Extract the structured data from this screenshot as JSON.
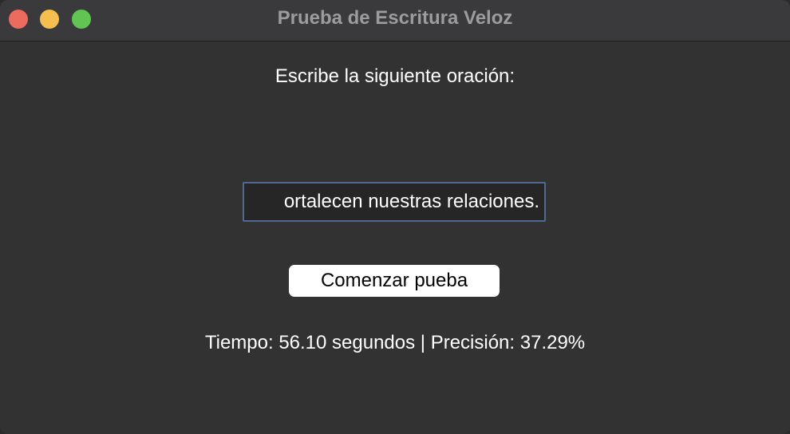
{
  "window": {
    "title": "Prueba de Escritura Veloz"
  },
  "main": {
    "prompt": "Escribe la siguiente oración:",
    "sentence_value": "ortalecen nuestras relaciones.",
    "start_button_label": "Comenzar pueba",
    "result": "Tiempo: 56.10 segundos | Precisión: 37.29%"
  },
  "colors": {
    "close": "#ec6a5e",
    "minimize": "#f4bf4f",
    "maximize": "#61c554",
    "field_border": "#4e6a93"
  }
}
